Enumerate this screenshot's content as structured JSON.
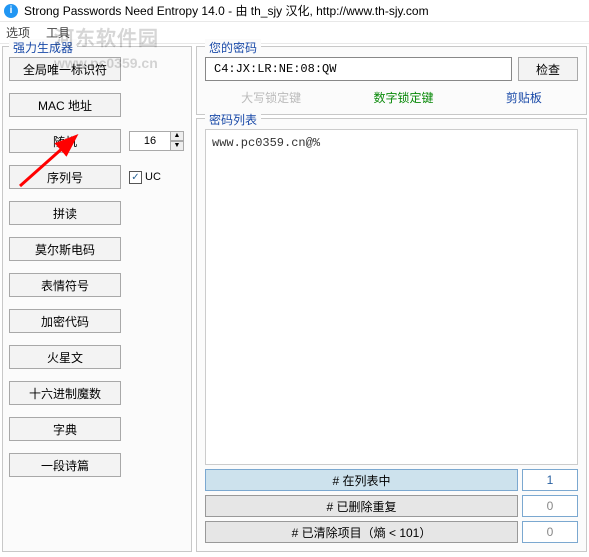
{
  "titlebar": {
    "icon_letter": "i",
    "title": "Strong Passwords Need Entropy 14.0 - 由 th_sjy 汉化, http://www.th-sjy.com"
  },
  "menu": {
    "items": [
      "选项",
      "工具"
    ]
  },
  "generator": {
    "title": "强力生成器",
    "buttons": [
      "全局唯一标识符",
      "MAC 地址",
      "随机",
      "序列号",
      "拼读",
      "莫尔斯电码",
      "表情符号",
      "加密代码",
      "火星文",
      "十六进制魔数",
      "字典",
      "一段诗篇"
    ],
    "random_length": "16",
    "uc_checked": true,
    "uc_label": "UC"
  },
  "your_password": {
    "title": "您的密码",
    "value": "C4:JX:LR:NE:08:QW",
    "check_button": "检查",
    "caps_label": "大写锁定键",
    "num_label": "数字锁定键",
    "clipboard_label": "剪贴板"
  },
  "password_list": {
    "title": "密码列表",
    "content": "www.pc0359.cn@%"
  },
  "stats": {
    "in_list_label": "# 在列表中",
    "in_list_value": "1",
    "dedup_label": "# 已删除重复",
    "dedup_value": "0",
    "cleared_label": "# 已清除项目（熵 < 101）",
    "cleared_value": "0"
  },
  "watermark": {
    "name": "河东软件园",
    "site": "www.pc0359.cn"
  }
}
